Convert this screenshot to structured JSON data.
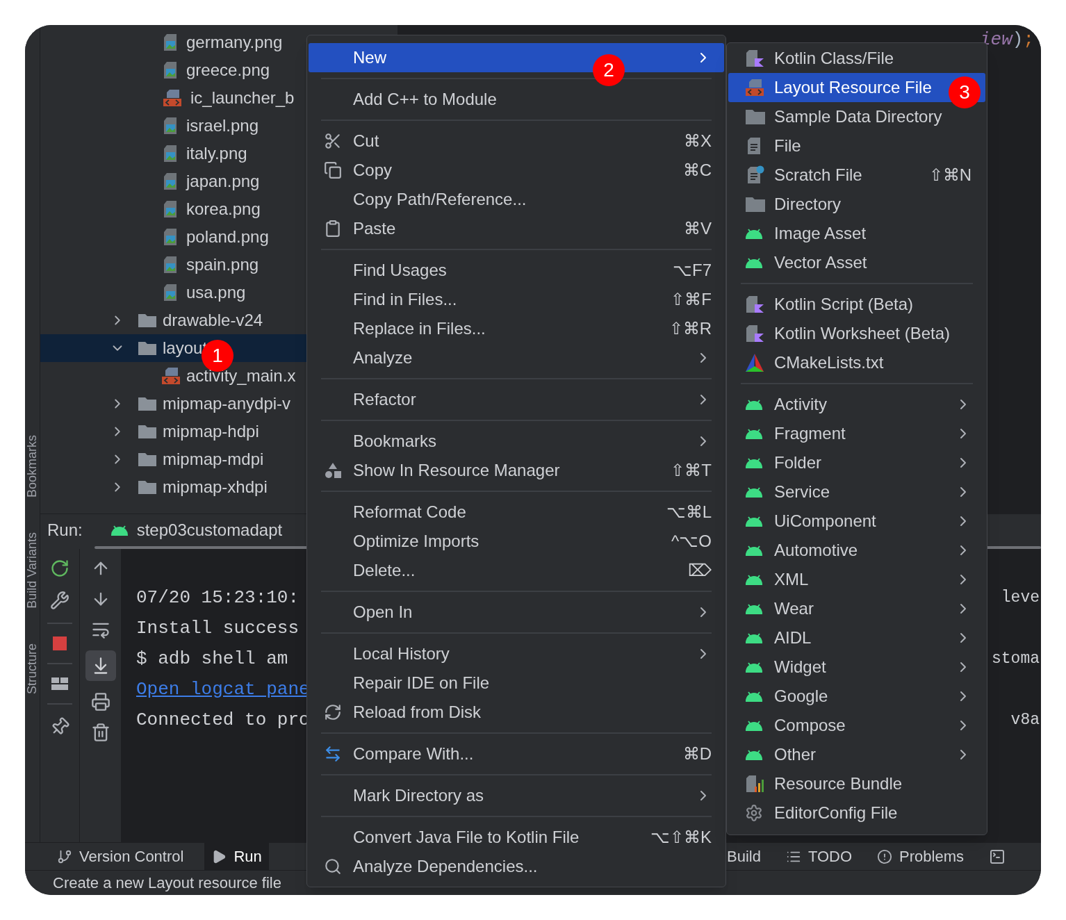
{
  "side_labels": [
    "Bookmarks",
    "Build Variants",
    "Structure"
  ],
  "project_tree": {
    "files": [
      {
        "label": "germany.png",
        "kind": "image"
      },
      {
        "label": "greece.png",
        "kind": "image"
      },
      {
        "label": "ic_launcher_b",
        "kind": "layout"
      },
      {
        "label": "israel.png",
        "kind": "image"
      },
      {
        "label": "italy.png",
        "kind": "image"
      },
      {
        "label": "japan.png",
        "kind": "image"
      },
      {
        "label": "korea.png",
        "kind": "image"
      },
      {
        "label": "poland.png",
        "kind": "image"
      },
      {
        "label": "spain.png",
        "kind": "image"
      },
      {
        "label": "usa.png",
        "kind": "image"
      }
    ],
    "folders": [
      {
        "label": "drawable-v24",
        "expanded": false,
        "selected": false
      },
      {
        "label": "layout",
        "expanded": true,
        "selected": true,
        "children": [
          {
            "label": "activity_main.x",
            "kind": "layout"
          }
        ]
      },
      {
        "label": "mipmap-anydpi-v",
        "expanded": false,
        "selected": false
      },
      {
        "label": "mipmap-hdpi",
        "expanded": false,
        "selected": false
      },
      {
        "label": "mipmap-mdpi",
        "expanded": false,
        "selected": false
      },
      {
        "label": "mipmap-xhdpi",
        "expanded": false,
        "selected": false
      }
    ]
  },
  "editor": {
    "code_parts": [
      {
        "text": "iew",
        "kind": "field"
      },
      {
        "text": ")",
        "kind": "punct"
      },
      {
        "text": ";",
        "kind": "semicolon"
      }
    ]
  },
  "run_panel": {
    "label": "Run:",
    "tab": "step03customadapt",
    "console": [
      {
        "text": "07/20 15:23:10:",
        "kind": "plain",
        "overflow": "leve"
      },
      {
        "text": "Install success",
        "kind": "plain"
      },
      {
        "text": "$ adb shell am",
        "kind": "plain",
        "overflow": "stoma"
      },
      {
        "text": "Open logcat pane",
        "kind": "link"
      },
      {
        "text": "Connected to pro",
        "kind": "plain",
        "overflow": "v8a"
      }
    ]
  },
  "tool_tabs": [
    {
      "label": "Version Control",
      "selected": false
    },
    {
      "label": "Run",
      "selected": true
    },
    {
      "label": "Build",
      "selected": false
    },
    {
      "label": "TODO",
      "selected": false
    },
    {
      "label": "Problems",
      "selected": false
    }
  ],
  "status_bar": {
    "text": "Create a new Layout resource file"
  },
  "context_menu": {
    "groups": [
      [
        {
          "label": "New",
          "has_submenu": true,
          "selected": true
        }
      ],
      [
        {
          "label": "Add C++ to Module",
          "has_submenu": false,
          "selected": false
        }
      ],
      [
        {
          "label": "Cut",
          "shortcut": "⌘X",
          "has_submenu": false,
          "selected": false
        },
        {
          "label": "Copy",
          "shortcut": "⌘C",
          "has_submenu": false,
          "selected": false
        },
        {
          "label": "Copy Path/Reference...",
          "has_submenu": false,
          "selected": false
        },
        {
          "label": "Paste",
          "shortcut": "⌘V",
          "has_submenu": false,
          "selected": false
        }
      ],
      [
        {
          "label": "Find Usages",
          "shortcut": "⌥F7",
          "has_submenu": false,
          "selected": false
        },
        {
          "label": "Find in Files...",
          "shortcut": "⇧⌘F",
          "has_submenu": false,
          "selected": false
        },
        {
          "label": "Replace in Files...",
          "shortcut": "⇧⌘R",
          "has_submenu": false,
          "selected": false
        },
        {
          "label": "Analyze",
          "has_submenu": true,
          "selected": false
        }
      ],
      [
        {
          "label": "Refactor",
          "has_submenu": true,
          "selected": false
        }
      ],
      [
        {
          "label": "Bookmarks",
          "has_submenu": true,
          "selected": false
        },
        {
          "label": "Show In Resource Manager",
          "shortcut": "⇧⌘T",
          "has_submenu": false,
          "selected": false
        }
      ],
      [
        {
          "label": "Reformat Code",
          "shortcut": "⌥⌘L",
          "has_submenu": false,
          "selected": false
        },
        {
          "label": "Optimize Imports",
          "shortcut": "^⌥O",
          "has_submenu": false,
          "selected": false
        },
        {
          "label": "Delete...",
          "shortcut": "⌦",
          "has_submenu": false,
          "selected": false
        }
      ],
      [
        {
          "label": "Open In",
          "has_submenu": true,
          "selected": false
        }
      ],
      [
        {
          "label": "Local History",
          "has_submenu": true,
          "selected": false
        },
        {
          "label": "Repair IDE on File",
          "has_submenu": false,
          "selected": false
        },
        {
          "label": "Reload from Disk",
          "has_submenu": false,
          "selected": false
        }
      ],
      [
        {
          "label": "Compare With...",
          "shortcut": "⌘D",
          "has_submenu": false,
          "selected": false
        }
      ],
      [
        {
          "label": "Mark Directory as",
          "has_submenu": true,
          "selected": false
        }
      ],
      [
        {
          "label": "Convert Java File to Kotlin File",
          "shortcut": "⌥⇧⌘K",
          "has_submenu": false,
          "selected": false
        },
        {
          "label": "Analyze Dependencies...",
          "has_submenu": false,
          "selected": false
        }
      ]
    ]
  },
  "submenu": {
    "groups": [
      [
        {
          "label": "Kotlin Class/File",
          "has_submenu": false,
          "selected": false
        },
        {
          "label": "Layout Resource File",
          "has_submenu": false,
          "selected": true
        },
        {
          "label": "Sample Data Directory",
          "has_submenu": false,
          "selected": false
        },
        {
          "label": "File",
          "has_submenu": false,
          "selected": false
        },
        {
          "label": "Scratch File",
          "shortcut": "⇧⌘N",
          "has_submenu": false,
          "selected": false
        },
        {
          "label": "Directory",
          "has_submenu": false,
          "selected": false
        },
        {
          "label": "Image Asset",
          "has_submenu": false,
          "selected": false
        },
        {
          "label": "Vector Asset",
          "has_submenu": false,
          "selected": false
        }
      ],
      [
        {
          "label": "Kotlin Script (Beta)",
          "has_submenu": false,
          "selected": false
        },
        {
          "label": "Kotlin Worksheet (Beta)",
          "has_submenu": false,
          "selected": false
        },
        {
          "label": "CMakeLists.txt",
          "has_submenu": false,
          "selected": false
        }
      ],
      [
        {
          "label": "Activity",
          "has_submenu": true,
          "selected": false
        },
        {
          "label": "Fragment",
          "has_submenu": true,
          "selected": false
        },
        {
          "label": "Folder",
          "has_submenu": true,
          "selected": false
        },
        {
          "label": "Service",
          "has_submenu": true,
          "selected": false
        },
        {
          "label": "UiComponent",
          "has_submenu": true,
          "selected": false
        },
        {
          "label": "Automotive",
          "has_submenu": true,
          "selected": false
        },
        {
          "label": "XML",
          "has_submenu": true,
          "selected": false
        },
        {
          "label": "Wear",
          "has_submenu": true,
          "selected": false
        },
        {
          "label": "AIDL",
          "has_submenu": true,
          "selected": false
        },
        {
          "label": "Widget",
          "has_submenu": true,
          "selected": false
        },
        {
          "label": "Google",
          "has_submenu": true,
          "selected": false
        },
        {
          "label": "Compose",
          "has_submenu": true,
          "selected": false
        },
        {
          "label": "Other",
          "has_submenu": true,
          "selected": false
        },
        {
          "label": "Resource Bundle",
          "has_submenu": false,
          "selected": false
        },
        {
          "label": "EditorConfig File",
          "has_submenu": false,
          "selected": false
        }
      ]
    ]
  },
  "markers": [
    "1",
    "2",
    "3"
  ]
}
